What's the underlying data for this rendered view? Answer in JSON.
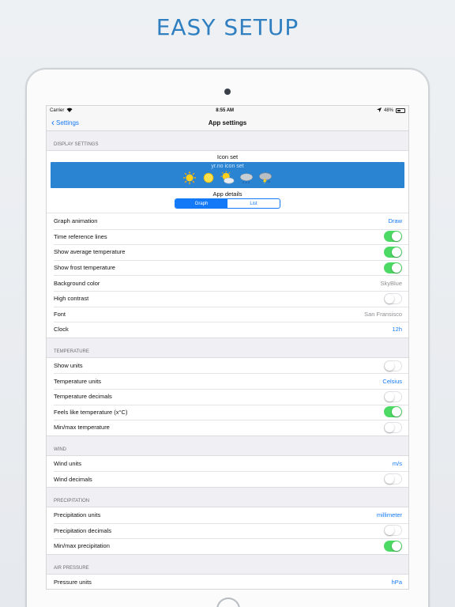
{
  "headline": "EASY SETUP",
  "status": {
    "carrier": "Carrier",
    "time": "8:55 AM",
    "battery": "48%"
  },
  "nav": {
    "back": "Settings",
    "title": "App settings"
  },
  "display": {
    "header": "DISPLAY SETTINGS",
    "iconset_title": "Icon set",
    "iconset_name": "yr.no icon set",
    "icons": [
      "sun-icon",
      "sun-small-icon",
      "partly-cloudy-icon",
      "rain-icon",
      "thunderstorm-icon"
    ],
    "app_details_title": "App details",
    "segments": [
      "Graph",
      "List"
    ],
    "rows": [
      {
        "label": "Graph animation",
        "value": "Draw",
        "kind": "blue"
      },
      {
        "label": "Time reference lines",
        "kind": "switch",
        "on": true
      },
      {
        "label": "Show average temperature",
        "kind": "switch",
        "on": true
      },
      {
        "label": "Show frost temperature",
        "kind": "switch",
        "on": true
      },
      {
        "label": "Background color",
        "value": "SkyBlue",
        "kind": "gray"
      },
      {
        "label": "High contrast",
        "kind": "switch",
        "on": false
      },
      {
        "label": "Font",
        "value": "San Fransisco",
        "kind": "gray"
      },
      {
        "label": "Clock",
        "value": "12h",
        "kind": "blue"
      }
    ]
  },
  "temperature": {
    "header": "TEMPERATURE",
    "rows": [
      {
        "label": "Show units",
        "kind": "switch",
        "on": false
      },
      {
        "label": "Temperature units",
        "value": "Celsius",
        "kind": "blue"
      },
      {
        "label": "Temperature decimals",
        "kind": "switch",
        "on": false
      },
      {
        "label": "Feels like temperature (x°C)",
        "kind": "switch",
        "on": true
      },
      {
        "label": "Min/max temperature",
        "kind": "switch",
        "on": false
      }
    ]
  },
  "wind": {
    "header": "WIND",
    "rows": [
      {
        "label": "Wind units",
        "value": "m/s",
        "kind": "blue"
      },
      {
        "label": "Wind decimals",
        "kind": "switch",
        "on": false
      }
    ]
  },
  "precipitation": {
    "header": "PRECIPITATION",
    "rows": [
      {
        "label": "Precipitation units",
        "value": "millimeter",
        "kind": "blue"
      },
      {
        "label": "Precipitation decimals",
        "kind": "switch",
        "on": false
      },
      {
        "label": "Min/max precipitation",
        "kind": "switch",
        "on": true
      }
    ]
  },
  "pressure": {
    "header": "AIR PRESSURE",
    "rows": [
      {
        "label": "Pressure units",
        "value": "hPa",
        "kind": "blue"
      }
    ]
  },
  "colors": {
    "accent": "#1479f6",
    "switch_on": "#4cd964",
    "band": "#2a84d2",
    "headline": "#2f7fc1"
  }
}
